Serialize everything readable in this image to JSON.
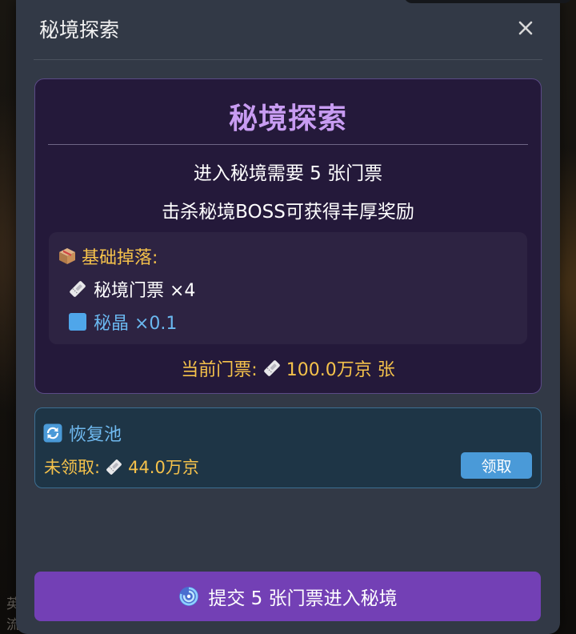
{
  "background": {
    "snippet_1": "英",
    "snippet_2": "流"
  },
  "modal": {
    "title": "秘境探索",
    "close_glyph": "✕"
  },
  "dungeon": {
    "title": "秘境探索",
    "requirement": "进入秘境需要 5 张门票",
    "reward_hint": "击杀秘境BOSS可获得丰厚奖励",
    "drops": {
      "title": "基础掉落:",
      "title_icon": "box-icon",
      "items": [
        {
          "icon": "ticket-icon",
          "label": "秘境门票 ×4",
          "color": "#ffffff"
        },
        {
          "icon": "crystal-icon",
          "label": "秘晶 ×0.1",
          "color": "#6ab8f0"
        }
      ]
    },
    "current_tickets": {
      "prefix": "当前门票:",
      "icon": "ticket-icon",
      "value": "100.0万京 张"
    }
  },
  "recovery_pool": {
    "icon": "refresh-icon",
    "title": "恢复池",
    "unclaimed_prefix": "未领取:",
    "unclaimed_icon": "ticket-icon",
    "unclaimed_value": "44.0万京",
    "claim_label": "领取"
  },
  "submit": {
    "icon": "swirl-icon",
    "label": "提交 5 张门票进入秘境"
  },
  "colors": {
    "modal_bg": "#323946",
    "card_bg": "#24193a",
    "card_title": "#c89cf2",
    "gold": "#f5c24b",
    "pool_bg": "#1e3546",
    "accent_blue": "#4a9ad8",
    "submit_bg": "#7340b5"
  }
}
